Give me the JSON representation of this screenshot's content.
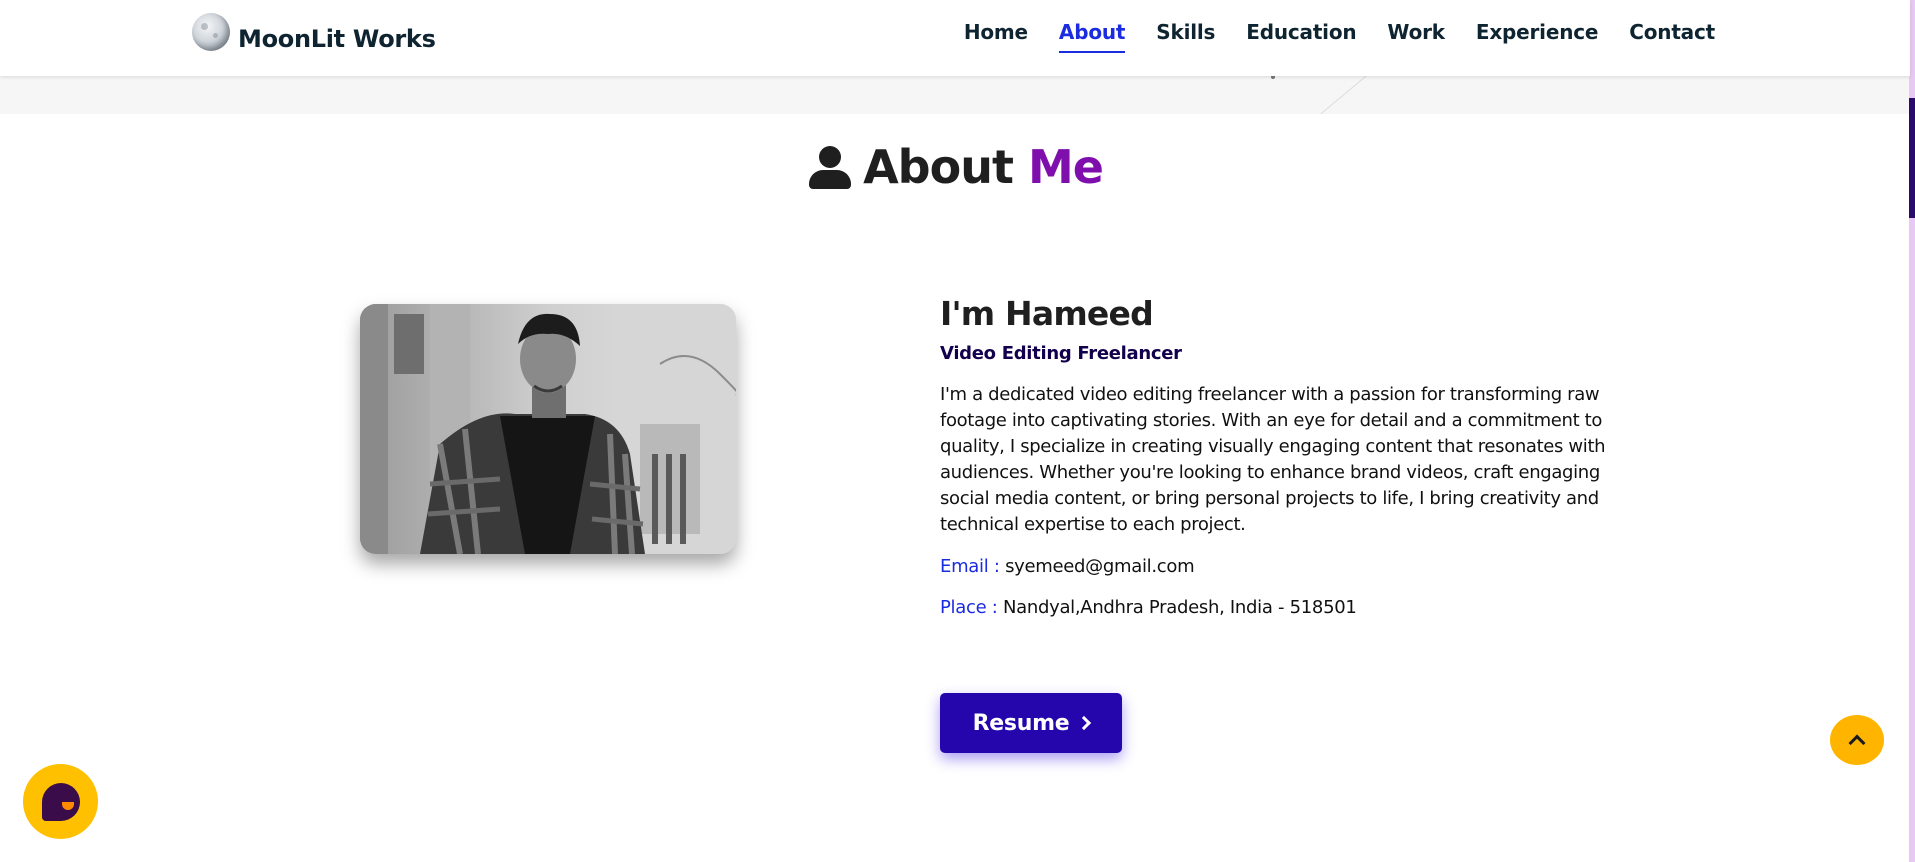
{
  "navbar": {
    "brand": "MoonLit Works",
    "links": [
      {
        "label": "Home",
        "active": false
      },
      {
        "label": "About",
        "active": true
      },
      {
        "label": "Skills",
        "active": false
      },
      {
        "label": "Education",
        "active": false
      },
      {
        "label": "Work",
        "active": false
      },
      {
        "label": "Experience",
        "active": false
      },
      {
        "label": "Contact",
        "active": false
      }
    ],
    "active_color": "#1a2be0"
  },
  "about": {
    "heading_main": "About",
    "heading_accent": "Me",
    "accent_color": "#7f0fad",
    "name": "I'm Hameed",
    "role": "Video Editing Freelancer",
    "bio": "I'm a dedicated video editing freelancer with a passion for transforming raw footage into captivating stories. With an eye for detail and a commitment to quality, I specialize in creating visually engaging content that resonates with audiences. Whether you're looking to enhance brand videos, craft engaging social media content, or bring personal projects to life, I bring creativity and technical expertise to each project.",
    "email_label": "Email :",
    "email": "syemeed@gmail.com",
    "place_label": "Place :",
    "place": "Nandyal,Andhra Pradesh, India - 518501",
    "resume_label": "Resume",
    "button_color": "#2506ad"
  },
  "icons": {
    "brand": "moon-icon",
    "heading": "user-icon",
    "resume": "chevron-right-icon",
    "scroll_top": "chevron-up-icon",
    "chat": "chat-icon"
  }
}
